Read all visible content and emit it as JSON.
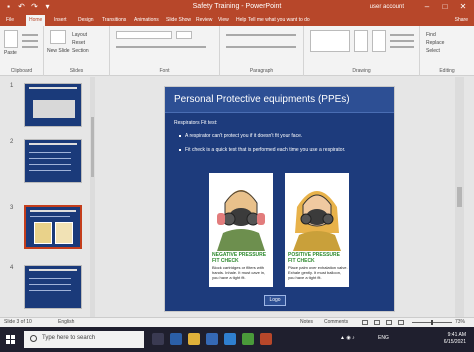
{
  "app": {
    "title": "Safety Training - PowerPoint",
    "user": "user account",
    "window_buttons": [
      "minimize",
      "maximize",
      "close"
    ]
  },
  "ribbon_tabs": [
    {
      "label": "File"
    },
    {
      "label": "Home",
      "active": true
    },
    {
      "label": "Insert"
    },
    {
      "label": "Design"
    },
    {
      "label": "Transitions"
    },
    {
      "label": "Animations"
    },
    {
      "label": "Slide Show"
    },
    {
      "label": "Review"
    },
    {
      "label": "View"
    },
    {
      "label": "Help"
    }
  ],
  "tell_me": "Tell me what you want to do",
  "share_label": "Share",
  "ribbon_groups": [
    {
      "label": "Clipboard"
    },
    {
      "label": "Slides"
    },
    {
      "label": "Font"
    },
    {
      "label": "Paragraph"
    },
    {
      "label": "Drawing"
    },
    {
      "label": "Editing"
    }
  ],
  "ribbon_texts": {
    "paste": "Paste",
    "layout": "Layout",
    "reset": "Reset",
    "section": "Section",
    "new_slide": "New Slide",
    "find": "Find",
    "replace": "Replace",
    "select": "Select"
  },
  "thumbnails": [
    {
      "number": "1"
    },
    {
      "number": "2"
    },
    {
      "number": "3"
    },
    {
      "number": "4"
    }
  ],
  "slide": {
    "title": "Personal Protective equipments (PPEs)",
    "subtitle": "Respirators Fit test:",
    "bullets": [
      "A respirator can't protect you if it doesn't fit your face.",
      "Fit check is a quick test that is performed each time you use a respirator."
    ],
    "panels": [
      {
        "heading": "NEGATIVE PRESSURE FIT CHECK",
        "body": "Block cartridges or filters with hands. Inhale. It must cave in, you have a tight fit."
      },
      {
        "heading": "POSITIVE PRESSURE FIT CHECK",
        "body": "Place palm over exhalation valve. Exhale gently. It must balloon, you have a tight fit."
      }
    ],
    "logo": "Logo"
  },
  "status_bar": {
    "slide_info": "Slide 3 of 10",
    "language": "English",
    "notes": "Notes",
    "comments": "Comments",
    "zoom": "73%"
  },
  "taskbar": {
    "search_placeholder": "Type here to search",
    "tray_text": "ENG",
    "time": "9:41 AM",
    "date": "6/15/2021"
  },
  "colors": {
    "accent": "#b7472a",
    "slide_bg": "#1d3b7c",
    "taskbar": "#1f1f2e"
  }
}
